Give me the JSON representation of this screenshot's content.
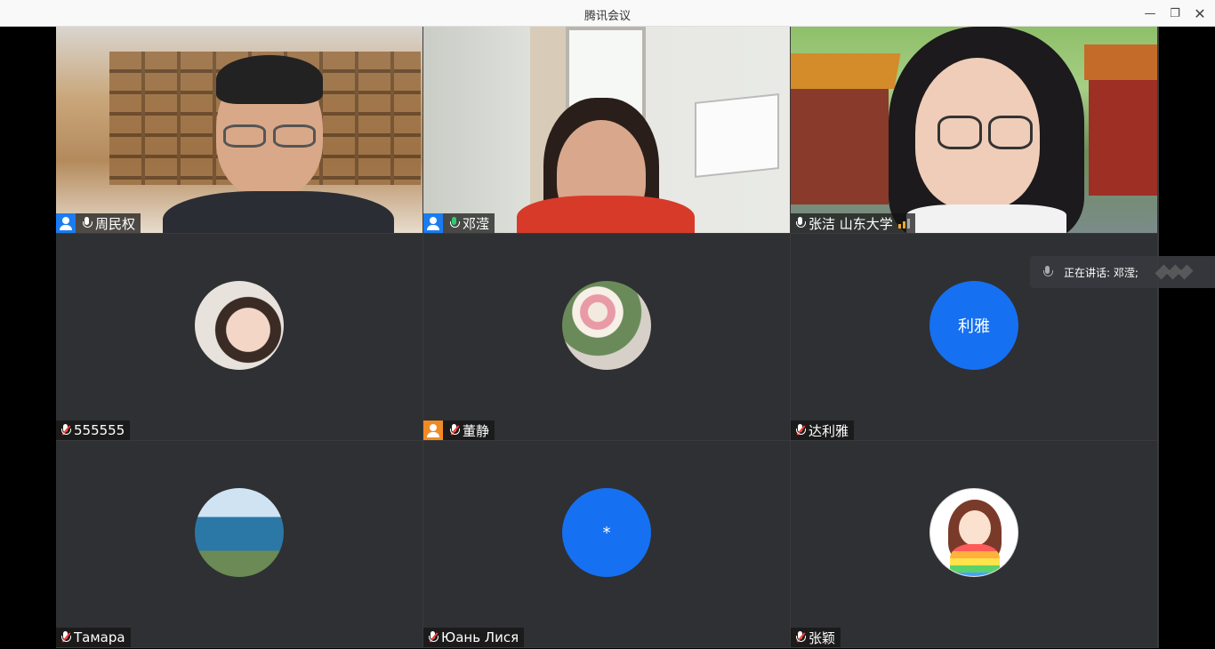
{
  "window": {
    "title": "腾讯会议"
  },
  "controls": {
    "minimize": "—",
    "maximize": "❐",
    "close": "✕"
  },
  "participants": [
    {
      "name": "周民权"
    },
    {
      "name": "邓滢"
    },
    {
      "name": "张洁 山东大学"
    },
    {
      "name": "555555"
    },
    {
      "name": "董静"
    },
    {
      "name": "达利雅",
      "avatar_text": "利雅"
    },
    {
      "name": "Тамара"
    },
    {
      "name": "Юань Лися",
      "avatar_text": "*"
    },
    {
      "name": "张颖"
    }
  ],
  "speaking": {
    "label": "正在讲话: 邓滢;"
  },
  "colors": {
    "host": "#1a7cf0",
    "cohost": "#f08a24",
    "avatar_blue": "#1670f2",
    "speaking_mic": "#2ecc71"
  }
}
